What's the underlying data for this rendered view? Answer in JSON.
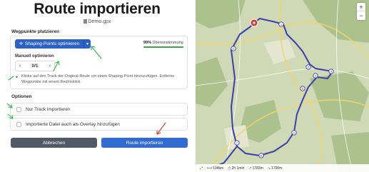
{
  "dialog": {
    "title": "Route importieren",
    "filename": "Demo.gpx",
    "waypoints_label": "Wegpunkte platzieren",
    "shape_button": "Shaping-Points optimieren",
    "match_percent": "99%",
    "match_label": "Übereinstimmung",
    "match_fraction": 0.99,
    "manual_label": "Manuell optimieren",
    "stepper_prev": "‹",
    "stepper_value": "0/1",
    "stepper_next": "›",
    "info_text": "Klicke auf den Track der Original-Route um einen Shaping-Point hinzuzufügen. Entferne Wegpunkte mit einem Rechtsklick.",
    "options_label": "Optionen",
    "option_track_only": "Nur Track importieren",
    "option_overlay": "Importierte Datei auch als Overlay hinzufügen",
    "cancel_button": "Abbrechen",
    "import_button": "Route importieren"
  },
  "map": {
    "zoom_in": "+",
    "zoom_out": "−",
    "stats": {
      "distance": "104km",
      "duration": "2h 1min",
      "ascent": "1783m",
      "descent": "1790m"
    },
    "waypoints": [
      "1",
      "2",
      "3",
      "4",
      "5",
      "6",
      "7",
      "8",
      "9"
    ]
  },
  "colors": {
    "primary": "#2f6bd2",
    "cancel": "#4f5a66",
    "route": "#3b3fa8",
    "match": "#3aa34a",
    "annotation": "#2db84a",
    "annotation_red": "#d83a2e"
  }
}
